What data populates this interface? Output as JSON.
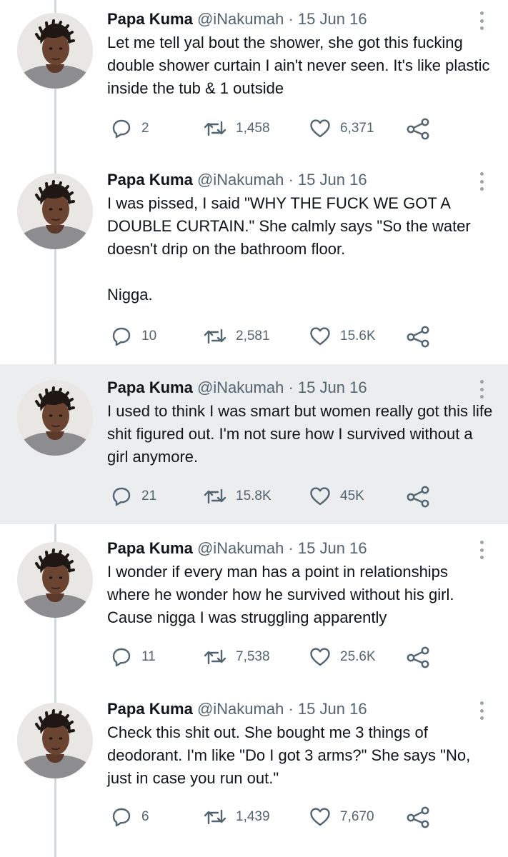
{
  "tweets": [
    {
      "name": "Papa Kuma",
      "handle": "@iNakumah",
      "separator": "·",
      "date": "15 Jun 16",
      "text": "Let me tell yal bout the shower, she got this fucking double shower curtain I ain't never seen. It's like plastic inside the tub & 1 outside",
      "replies": "2",
      "retweets": "1,458",
      "likes": "6,371",
      "highlighted": false
    },
    {
      "name": "Papa Kuma",
      "handle": "@iNakumah",
      "separator": "·",
      "date": "15 Jun 16",
      "text": "I was pissed, I said \"WHY THE FUCK WE GOT A DOUBLE CURTAIN.\" She calmly says \"So the water doesn't drip on the bathroom floor.\n\nNigga.",
      "replies": "10",
      "retweets": "2,581",
      "likes": "15.6K",
      "highlighted": false
    },
    {
      "name": "Papa Kuma",
      "handle": "@iNakumah",
      "separator": "·",
      "date": "15 Jun 16",
      "text": "I used to think I was smart but women really got this life shit figured out. I'm not sure how I survived without a girl anymore.",
      "replies": "21",
      "retweets": "15.8K",
      "likes": "45K",
      "highlighted": true
    },
    {
      "name": "Papa Kuma",
      "handle": "@iNakumah",
      "separator": "·",
      "date": "15 Jun 16",
      "text": "I wonder if every man has a point in relationships where he wonder how he survived without his girl. Cause nigga I was struggling apparently",
      "replies": "11",
      "retweets": "7,538",
      "likes": "25.6K",
      "highlighted": false
    },
    {
      "name": "Papa Kuma",
      "handle": "@iNakumah",
      "separator": "·",
      "date": "15 Jun 16",
      "text": "Check this shit out. She bought me 3 things of deodorant. I'm like \"Do I got 3 arms?\" She says \"No, just in case you run out.\"",
      "replies": "6",
      "retweets": "1,439",
      "likes": "7,670",
      "highlighted": false
    }
  ],
  "icons": {
    "reply": "reply-icon",
    "retweet": "retweet-icon",
    "like": "heart-icon",
    "share": "share-icon",
    "more": "more-icon"
  },
  "colors": {
    "text": "#0f1419",
    "muted": "#536471",
    "highlight_bg": "#ebedef",
    "thread_line": "#cfd9de"
  }
}
